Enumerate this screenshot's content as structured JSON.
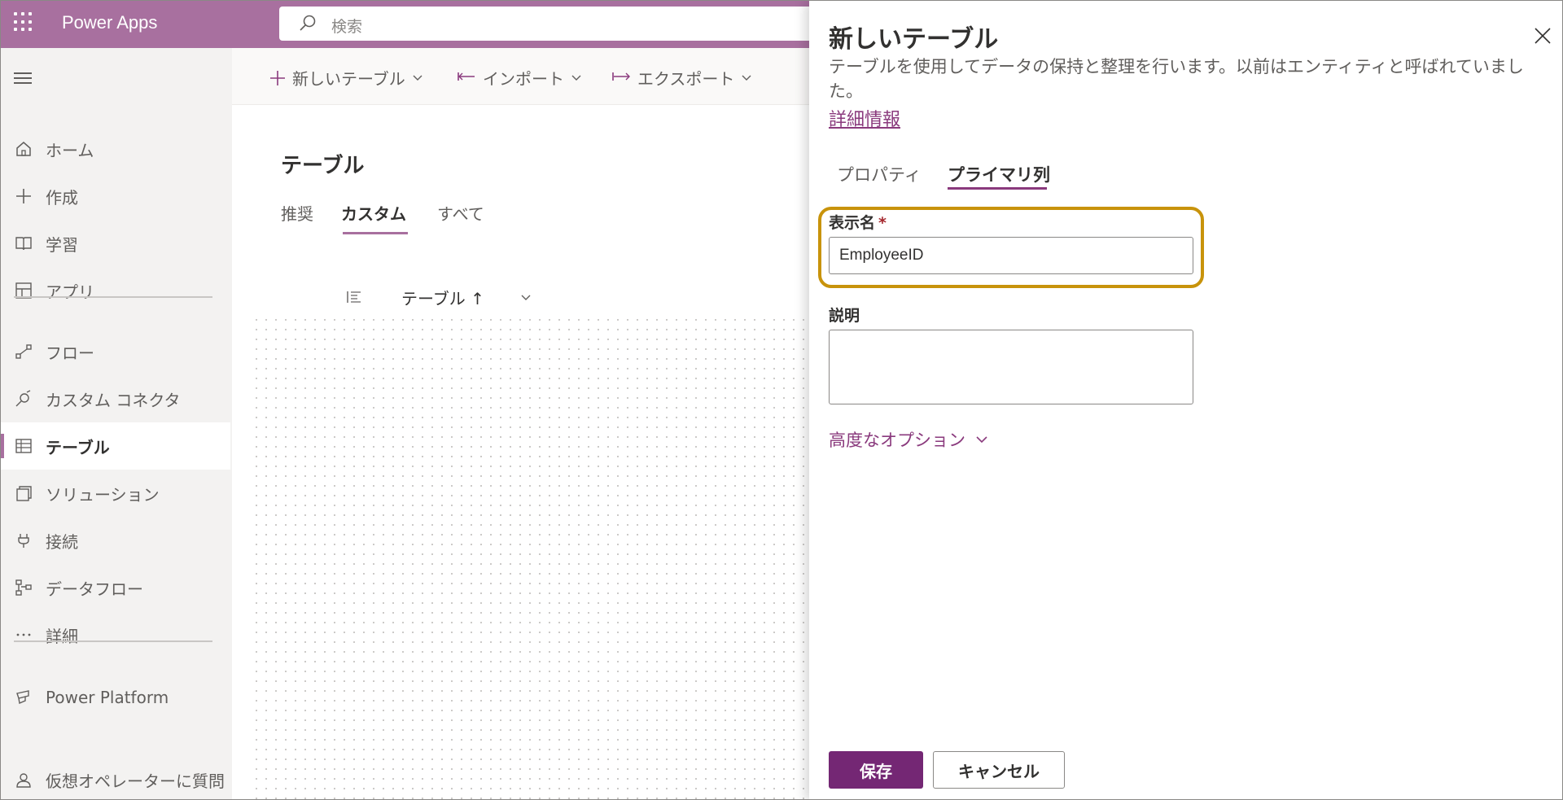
{
  "app": {
    "name": "Power Apps"
  },
  "search": {
    "placeholder": "検索"
  },
  "sidebar": {
    "items": [
      {
        "label": "ホーム",
        "icon": "home-icon"
      },
      {
        "label": "作成",
        "icon": "plus-icon"
      },
      {
        "label": "学習",
        "icon": "book-icon"
      },
      {
        "label": "アプリ",
        "icon": "apps-icon"
      },
      {
        "label": "フロー",
        "icon": "flow-icon"
      },
      {
        "label": "カスタム コネクタ",
        "icon": "connector-icon"
      },
      {
        "label": "テーブル",
        "icon": "table-icon",
        "active": true
      },
      {
        "label": "ソリューション",
        "icon": "solution-icon"
      },
      {
        "label": "接続",
        "icon": "plug-icon"
      },
      {
        "label": "データフロー",
        "icon": "dataflow-icon"
      },
      {
        "label": "詳細",
        "icon": "more-icon"
      },
      {
        "label": "Power Platform",
        "icon": "power-platform-icon"
      },
      {
        "label": "仮想オペレーターに質問",
        "icon": "agent-icon"
      }
    ]
  },
  "toolbar": {
    "new_table": "新しいテーブル",
    "import": "インポート",
    "export": "エクスポート"
  },
  "page": {
    "title": "テーブル",
    "tabs": [
      {
        "label": "推奨"
      },
      {
        "label": "カスタム",
        "active": true
      },
      {
        "label": "すべて"
      }
    ],
    "column_header": "テーブル ↑"
  },
  "panel": {
    "title": "新しいテーブル",
    "description": "テーブルを使用してデータの保持と整理を行います。以前はエンティティと呼ばれていました。",
    "link": "詳細情報",
    "tabs": [
      {
        "label": "プロパティ"
      },
      {
        "label": "プライマリ列",
        "active": true
      }
    ],
    "display_name_label": "表示名",
    "required_marker": "*",
    "display_name_value": "EmployeeID",
    "description_label": "説明",
    "description_value": "",
    "advanced_options": "高度なオプション",
    "save": "保存",
    "cancel": "キャンセル"
  },
  "colors": {
    "brand": "#a8709f",
    "accent": "#742774",
    "highlight": "#c8930b"
  }
}
